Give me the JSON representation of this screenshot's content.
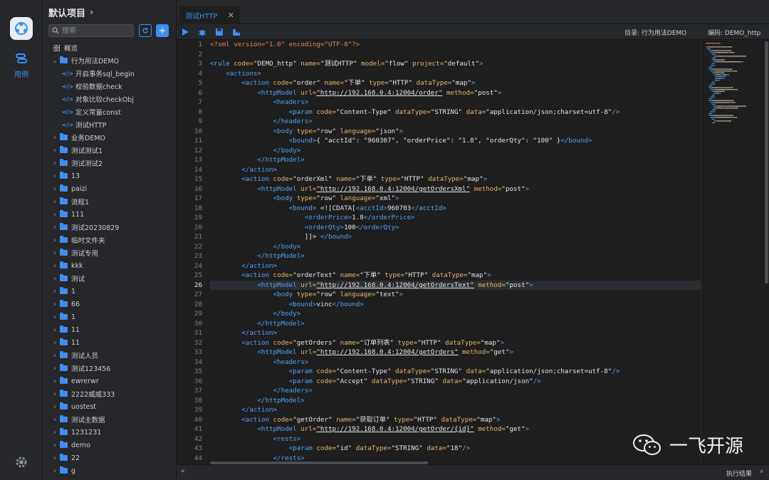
{
  "rail": {
    "item_label": "用例"
  },
  "sidebar": {
    "title": "默认项目",
    "search_placeholder": "搜索",
    "overview": "概览",
    "items": [
      {
        "label": "行为用法DEMO",
        "type": "folder",
        "expanded": true,
        "depth": 0
      },
      {
        "label": "开启事务sql_begin",
        "type": "file",
        "depth": 1
      },
      {
        "label": "校验数据check",
        "type": "file",
        "depth": 1
      },
      {
        "label": "对象比较checkObj",
        "type": "file",
        "depth": 1
      },
      {
        "label": "定义常量const",
        "type": "file",
        "depth": 1
      },
      {
        "label": "测试HTTP",
        "type": "file",
        "depth": 1
      },
      {
        "label": "业务DEMO",
        "type": "folder",
        "depth": 0
      },
      {
        "label": "测试测试1",
        "type": "folder",
        "depth": 0
      },
      {
        "label": "测试测试2",
        "type": "folder",
        "depth": 0
      },
      {
        "label": "13",
        "type": "folder",
        "depth": 0
      },
      {
        "label": "paizi",
        "type": "folder",
        "depth": 0
      },
      {
        "label": "流程1",
        "type": "folder",
        "depth": 0
      },
      {
        "label": "111",
        "type": "folder",
        "depth": 0
      },
      {
        "label": "测试20230829",
        "type": "folder",
        "depth": 0
      },
      {
        "label": "临时文件夹",
        "type": "folder",
        "depth": 0
      },
      {
        "label": "测试专用",
        "type": "folder",
        "depth": 0
      },
      {
        "label": "kkk",
        "type": "folder",
        "depth": 0
      },
      {
        "label": "测试",
        "type": "folder",
        "depth": 0
      },
      {
        "label": "1",
        "type": "folder",
        "depth": 0
      },
      {
        "label": "66",
        "type": "folder",
        "depth": 0
      },
      {
        "label": "1",
        "type": "folder",
        "depth": 0
      },
      {
        "label": "11",
        "type": "folder",
        "depth": 0
      },
      {
        "label": "11",
        "type": "folder",
        "depth": 0
      },
      {
        "label": "测试人员",
        "type": "folder",
        "depth": 0
      },
      {
        "label": "测试123456",
        "type": "folder",
        "depth": 0
      },
      {
        "label": "ewrerwr",
        "type": "folder",
        "depth": 0
      },
      {
        "label": "2222威威333",
        "type": "folder",
        "depth": 0
      },
      {
        "label": "uostest",
        "type": "folder",
        "depth": 0
      },
      {
        "label": "测试主数据",
        "type": "folder",
        "depth": 0
      },
      {
        "label": "1231231",
        "type": "folder",
        "depth": 0
      },
      {
        "label": "demo",
        "type": "folder",
        "depth": 0
      },
      {
        "label": "22",
        "type": "folder",
        "depth": 0
      },
      {
        "label": "g",
        "type": "folder",
        "depth": 0
      }
    ]
  },
  "tab": {
    "label": "测试HTTP",
    "close": "✕"
  },
  "toolbar": {
    "directory": "目录: 行为用法DEMO",
    "code": "编码: DEMO_http"
  },
  "status": {
    "collapse": "«",
    "result": "执行结果",
    "expand": "«"
  },
  "watermark": {
    "text": "一飞开源"
  },
  "editor": {
    "highlight_line": 26,
    "lines": [
      [
        [
          "pi",
          "<?xml version=\"1.0\" encoding=\"UTF-8\"?>"
        ]
      ],
      [],
      [
        [
          "tag",
          "<rule "
        ],
        [
          "attr",
          "code="
        ],
        [
          "str",
          "\"DEMO_http\" "
        ],
        [
          "attr",
          "name="
        ],
        [
          "str",
          "\"测试HTTP\" "
        ],
        [
          "attr",
          "model="
        ],
        [
          "str",
          "\"flow\" "
        ],
        [
          "attr",
          "project="
        ],
        [
          "str",
          "\"default\""
        ],
        [
          "tag",
          ">"
        ]
      ],
      [
        [
          "sym",
          "    "
        ],
        [
          "tag",
          "<actions>"
        ]
      ],
      [
        [
          "sym",
          "        "
        ],
        [
          "tag",
          "<action "
        ],
        [
          "attr",
          "code="
        ],
        [
          "str",
          "\"order\" "
        ],
        [
          "attr",
          "name="
        ],
        [
          "str",
          "\"下单\" "
        ],
        [
          "attr",
          "type="
        ],
        [
          "str",
          "\"HTTP\" "
        ],
        [
          "attr",
          "dataType="
        ],
        [
          "str",
          "\"map\""
        ],
        [
          "tag",
          ">"
        ]
      ],
      [
        [
          "sym",
          "            "
        ],
        [
          "tag",
          "<httpModel "
        ],
        [
          "attr",
          "url="
        ],
        [
          "url",
          "\"http://192.168.0.4:12004/order\""
        ],
        [
          "sym",
          " "
        ],
        [
          "attr",
          "method="
        ],
        [
          "str",
          "\"post\""
        ],
        [
          "tag",
          ">"
        ]
      ],
      [
        [
          "sym",
          "                "
        ],
        [
          "tag",
          "<headers>"
        ]
      ],
      [
        [
          "sym",
          "                    "
        ],
        [
          "tag",
          "<param "
        ],
        [
          "attr",
          "code="
        ],
        [
          "str",
          "\"Content-Type\" "
        ],
        [
          "attr",
          "dataType="
        ],
        [
          "str",
          "\"STRING\" "
        ],
        [
          "attr",
          "data="
        ],
        [
          "str",
          "\"application/json;charset=utf-8\""
        ],
        [
          "tag",
          "/>"
        ]
      ],
      [
        [
          "sym",
          "                "
        ],
        [
          "tag",
          "</headers>"
        ]
      ],
      [
        [
          "sym",
          "                "
        ],
        [
          "tag",
          "<body "
        ],
        [
          "attr",
          "type="
        ],
        [
          "str",
          "\"row\" "
        ],
        [
          "attr",
          "language="
        ],
        [
          "str",
          "\"json\""
        ],
        [
          "tag",
          ">"
        ]
      ],
      [
        [
          "sym",
          "                    "
        ],
        [
          "tag",
          "<bound>"
        ],
        [
          "str",
          "{ \"acctId\": \"960307\", \"orderPrice\": \"1.8\", \"orderQty\": \"100\" }"
        ],
        [
          "tag",
          "</bound>"
        ]
      ],
      [
        [
          "sym",
          "                "
        ],
        [
          "tag",
          "</body>"
        ]
      ],
      [
        [
          "sym",
          "            "
        ],
        [
          "tag",
          "</httpModel>"
        ]
      ],
      [
        [
          "sym",
          "        "
        ],
        [
          "tag",
          "</action>"
        ]
      ],
      [
        [
          "sym",
          "        "
        ],
        [
          "tag",
          "<action "
        ],
        [
          "attr",
          "code="
        ],
        [
          "str",
          "\"orderXml\" "
        ],
        [
          "attr",
          "name="
        ],
        [
          "str",
          "\"下单\" "
        ],
        [
          "attr",
          "type="
        ],
        [
          "str",
          "\"HTTP\" "
        ],
        [
          "attr",
          "dataType="
        ],
        [
          "str",
          "\"map\""
        ],
        [
          "tag",
          ">"
        ]
      ],
      [
        [
          "sym",
          "            "
        ],
        [
          "tag",
          "<httpModel "
        ],
        [
          "attr",
          "url="
        ],
        [
          "url",
          "\"http://192.168.0.4:12004/getOrdersXml\""
        ],
        [
          "sym",
          " "
        ],
        [
          "attr",
          "method="
        ],
        [
          "str",
          "\"post\""
        ],
        [
          "tag",
          ">"
        ]
      ],
      [
        [
          "sym",
          "                "
        ],
        [
          "tag",
          "<body "
        ],
        [
          "attr",
          "type="
        ],
        [
          "str",
          "\"row\" "
        ],
        [
          "attr",
          "language="
        ],
        [
          "str",
          "\"xml\""
        ],
        [
          "tag",
          ">"
        ]
      ],
      [
        [
          "sym",
          "                    "
        ],
        [
          "tag",
          "<bound>"
        ],
        [
          "str",
          " <![CDATA["
        ],
        [
          "tag",
          "<acctId>"
        ],
        [
          "str",
          "960703"
        ],
        [
          "tag",
          "</acctId>"
        ]
      ],
      [
        [
          "sym",
          "                        "
        ],
        [
          "tag",
          "<orderPrice>"
        ],
        [
          "str",
          "1.8"
        ],
        [
          "tag",
          "</orderPrice>"
        ]
      ],
      [
        [
          "sym",
          "                        "
        ],
        [
          "tag",
          "<orderQty>"
        ],
        [
          "str",
          "100"
        ],
        [
          "tag",
          "</orderQty>"
        ]
      ],
      [
        [
          "sym",
          "                        "
        ],
        [
          "str",
          "]]> "
        ],
        [
          "tag",
          "</bound>"
        ]
      ],
      [
        [
          "sym",
          "                "
        ],
        [
          "tag",
          "</body>"
        ]
      ],
      [
        [
          "sym",
          "            "
        ],
        [
          "tag",
          "</httpModel>"
        ]
      ],
      [
        [
          "sym",
          "        "
        ],
        [
          "tag",
          "</action>"
        ]
      ],
      [
        [
          "sym",
          "        "
        ],
        [
          "tag",
          "<action "
        ],
        [
          "attr",
          "code="
        ],
        [
          "str",
          "\"orderText\" "
        ],
        [
          "attr",
          "name="
        ],
        [
          "str",
          "\"下单\" "
        ],
        [
          "attr",
          "type="
        ],
        [
          "str",
          "\"HTTP\" "
        ],
        [
          "attr",
          "dataType="
        ],
        [
          "str",
          "\"map\""
        ],
        [
          "tag",
          ">"
        ]
      ],
      [
        [
          "sym",
          "            "
        ],
        [
          "tag",
          "<httpModel "
        ],
        [
          "attr",
          "url="
        ],
        [
          "url",
          "\"http://192.168.0.4:12004/getOrdersText\""
        ],
        [
          "sym",
          " "
        ],
        [
          "attr",
          "method="
        ],
        [
          "str",
          "\"post\""
        ],
        [
          "tag",
          ">"
        ]
      ],
      [
        [
          "sym",
          "                "
        ],
        [
          "tag",
          "<body "
        ],
        [
          "attr",
          "type="
        ],
        [
          "str",
          "\"row\" "
        ],
        [
          "attr",
          "language="
        ],
        [
          "str",
          "\"text\""
        ],
        [
          "tag",
          ">"
        ]
      ],
      [
        [
          "sym",
          "                    "
        ],
        [
          "tag",
          "<bound>"
        ],
        [
          "str",
          "vinc"
        ],
        [
          "tag",
          "</bound>"
        ]
      ],
      [
        [
          "sym",
          "                "
        ],
        [
          "tag",
          "</body>"
        ]
      ],
      [
        [
          "sym",
          "            "
        ],
        [
          "tag",
          "</httpModel>"
        ]
      ],
      [
        [
          "sym",
          "        "
        ],
        [
          "tag",
          "</action>"
        ]
      ],
      [
        [
          "sym",
          "        "
        ],
        [
          "tag",
          "<action "
        ],
        [
          "attr",
          "code="
        ],
        [
          "str",
          "\"getOrders\" "
        ],
        [
          "attr",
          "name="
        ],
        [
          "str",
          "\"订单列表\" "
        ],
        [
          "attr",
          "type="
        ],
        [
          "str",
          "\"HTTP\" "
        ],
        [
          "attr",
          "dataType="
        ],
        [
          "str",
          "\"map\""
        ],
        [
          "tag",
          ">"
        ]
      ],
      [
        [
          "sym",
          "            "
        ],
        [
          "tag",
          "<httpModel "
        ],
        [
          "attr",
          "url="
        ],
        [
          "url",
          "\"http://192.168.0.4:12004/getOrders\""
        ],
        [
          "sym",
          " "
        ],
        [
          "attr",
          "method="
        ],
        [
          "str",
          "\"get\""
        ],
        [
          "tag",
          ">"
        ]
      ],
      [
        [
          "sym",
          "                "
        ],
        [
          "tag",
          "<headers>"
        ]
      ],
      [
        [
          "sym",
          "                    "
        ],
        [
          "tag",
          "<param "
        ],
        [
          "attr",
          "code="
        ],
        [
          "str",
          "\"Content-Type\" "
        ],
        [
          "attr",
          "dataType="
        ],
        [
          "str",
          "\"STRING\" "
        ],
        [
          "attr",
          "data="
        ],
        [
          "str",
          "\"application/json;charset=utf-8\""
        ],
        [
          "tag",
          "/>"
        ]
      ],
      [
        [
          "sym",
          "                    "
        ],
        [
          "tag",
          "<param "
        ],
        [
          "attr",
          "code="
        ],
        [
          "str",
          "\"Accept\" "
        ],
        [
          "attr",
          "dataType="
        ],
        [
          "str",
          "\"STRING\" "
        ],
        [
          "attr",
          "data="
        ],
        [
          "str",
          "\"application/json\""
        ],
        [
          "tag",
          "/>"
        ]
      ],
      [
        [
          "sym",
          "                "
        ],
        [
          "tag",
          "</headers>"
        ]
      ],
      [
        [
          "sym",
          "            "
        ],
        [
          "tag",
          "</httpModel>"
        ]
      ],
      [
        [
          "sym",
          "        "
        ],
        [
          "tag",
          "</action>"
        ]
      ],
      [
        [
          "sym",
          "        "
        ],
        [
          "tag",
          "<action "
        ],
        [
          "attr",
          "code="
        ],
        [
          "str",
          "\"getOrder\" "
        ],
        [
          "attr",
          "name="
        ],
        [
          "str",
          "\"获取订单\" "
        ],
        [
          "attr",
          "type="
        ],
        [
          "str",
          "\"HTTP\" "
        ],
        [
          "attr",
          "dataType="
        ],
        [
          "str",
          "\"map\""
        ],
        [
          "tag",
          ">"
        ]
      ],
      [
        [
          "sym",
          "            "
        ],
        [
          "tag",
          "<httpModel "
        ],
        [
          "attr",
          "url="
        ],
        [
          "url",
          "\"http://192.168.0.4:12004/getOrder/{id}\""
        ],
        [
          "sym",
          " "
        ],
        [
          "attr",
          "method="
        ],
        [
          "str",
          "\"get\""
        ],
        [
          "tag",
          ">"
        ]
      ],
      [
        [
          "sym",
          "                "
        ],
        [
          "tag",
          "<rests>"
        ]
      ],
      [
        [
          "sym",
          "                    "
        ],
        [
          "tag",
          "<param "
        ],
        [
          "attr",
          "code="
        ],
        [
          "str",
          "\"id\" "
        ],
        [
          "attr",
          "dataType="
        ],
        [
          "str",
          "\"STRING\" "
        ],
        [
          "attr",
          "data="
        ],
        [
          "str",
          "\"18\""
        ],
        [
          "tag",
          "/>"
        ]
      ],
      [
        [
          "sym",
          "                "
        ],
        [
          "tag",
          "</rests>"
        ]
      ]
    ]
  }
}
